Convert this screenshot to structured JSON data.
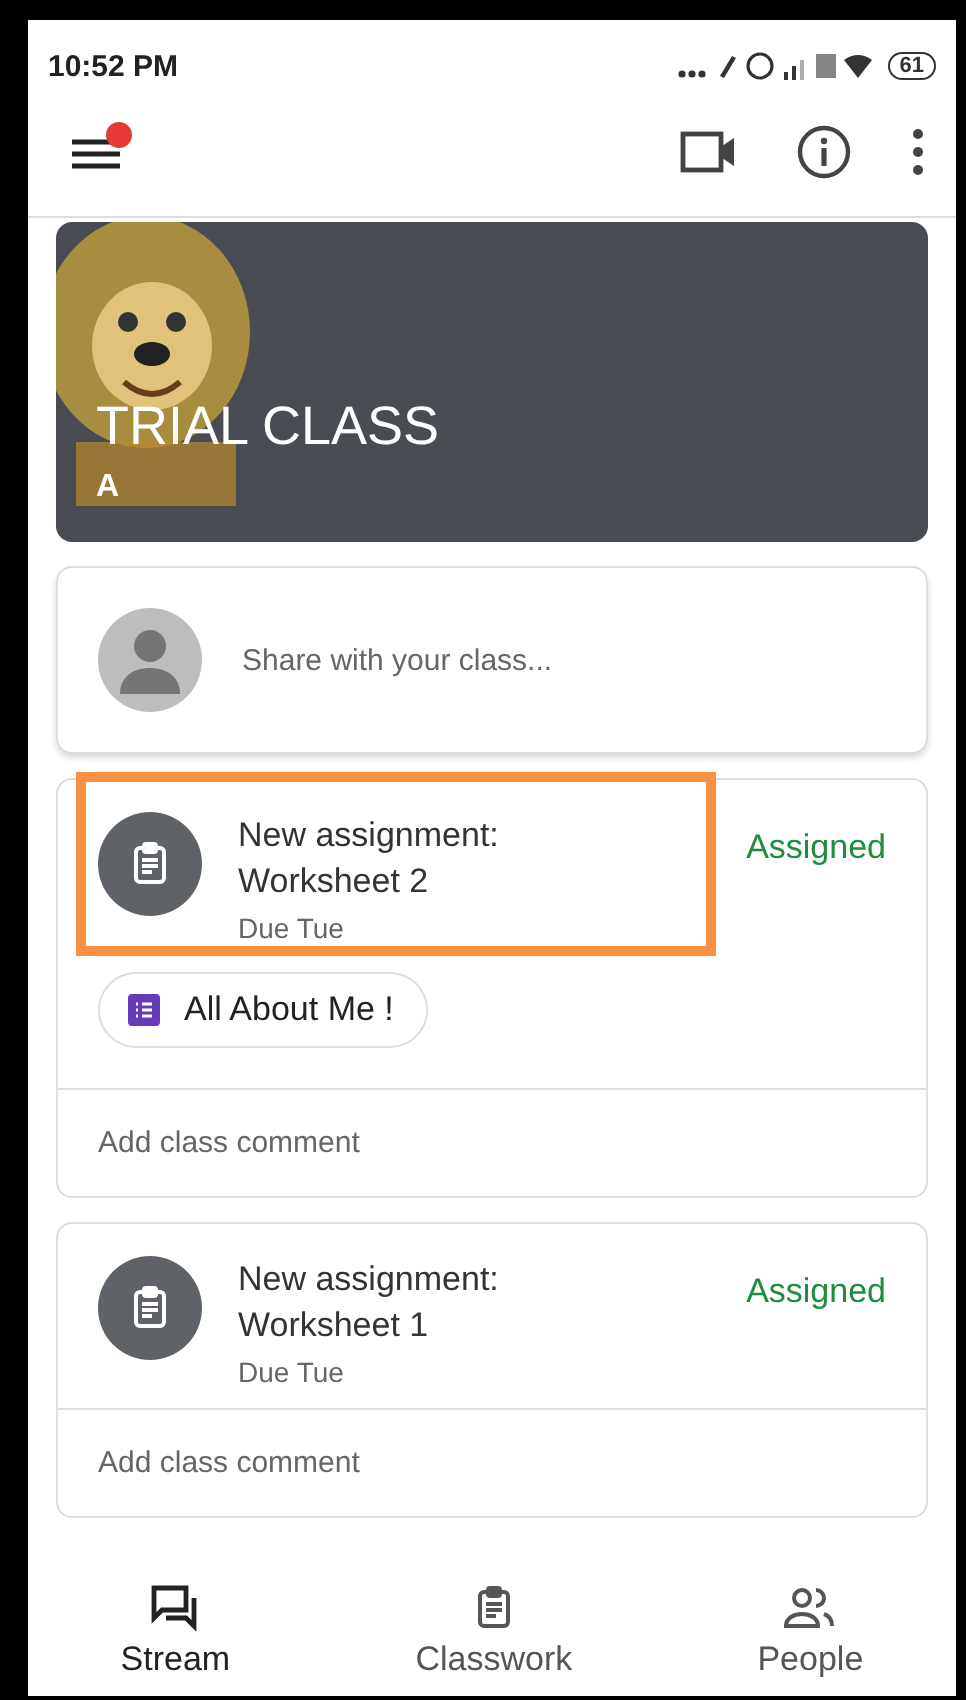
{
  "status_bar": {
    "time": "10:52 PM",
    "battery": "61"
  },
  "toolbar": {
    "menu_badge": true
  },
  "banner": {
    "title": "TRIAL CLASS",
    "section": "A"
  },
  "share": {
    "placeholder": "Share with your class..."
  },
  "posts": [
    {
      "title": "New assignment:\nWorksheet 2",
      "due": "Due Tue",
      "status": "Assigned",
      "highlighted": true,
      "attachments": [
        {
          "label": "All About Me !"
        }
      ],
      "comment_placeholder": "Add class comment"
    },
    {
      "title": "New assignment:\nWorksheet 1",
      "due": "Due Tue",
      "status": "Assigned",
      "highlighted": false,
      "comment_placeholder": "Add class comment"
    }
  ],
  "bottom_nav": [
    {
      "label": "Stream",
      "kind": "stream",
      "selected": true
    },
    {
      "label": "Classwork",
      "kind": "classwork",
      "selected": false
    },
    {
      "label": "People",
      "kind": "people",
      "selected": false
    }
  ]
}
